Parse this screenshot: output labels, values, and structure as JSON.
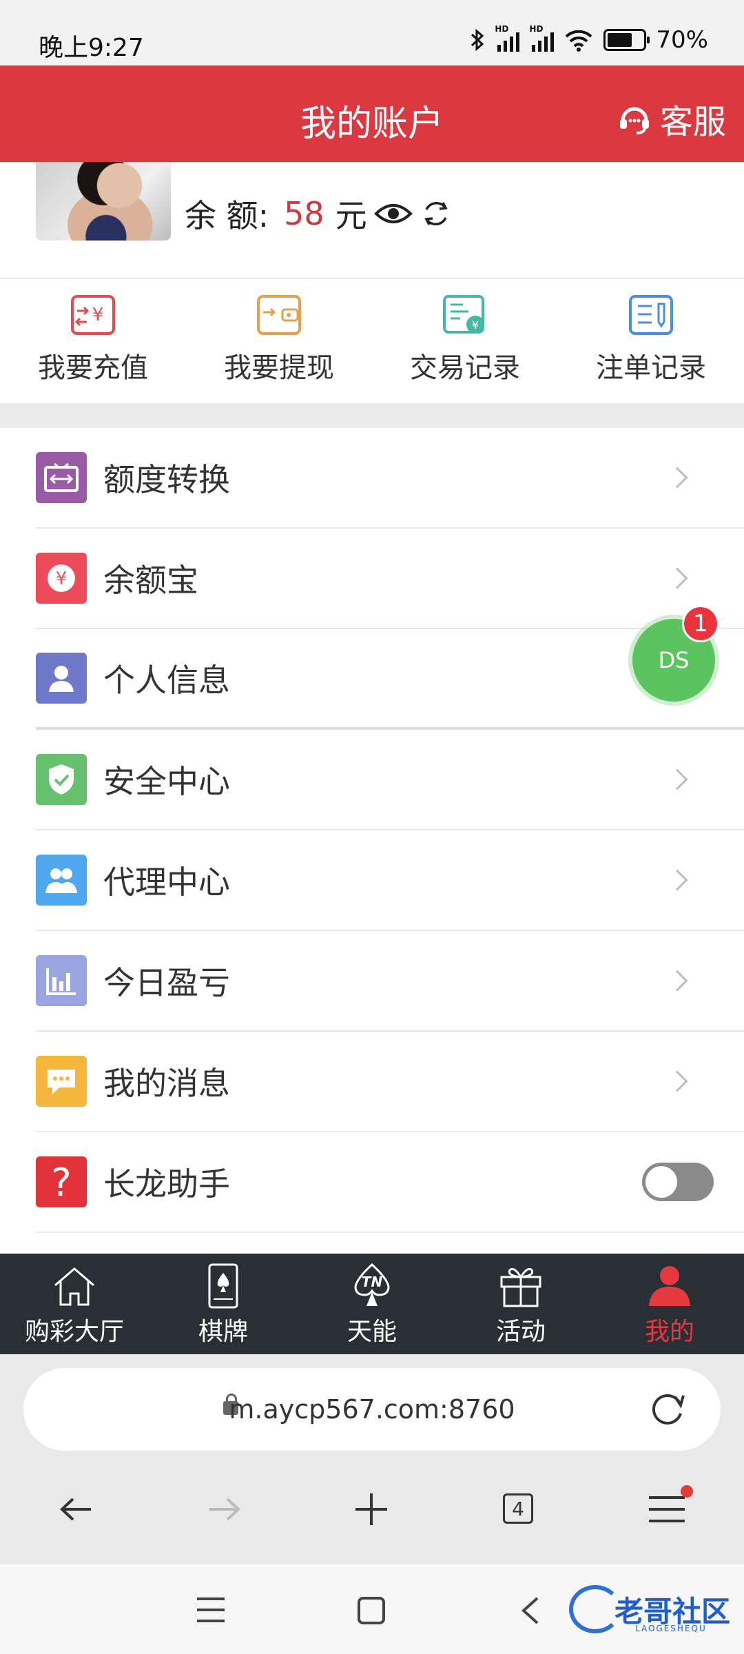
{
  "status_bar": {
    "time": "晚上9:27",
    "battery": "70%",
    "battery_level": 0.7
  },
  "header": {
    "title": "我的账户",
    "service_label": "客服"
  },
  "profile": {
    "balance_label": "余 额:",
    "balance_value": "58",
    "currency": "元"
  },
  "quick_actions": [
    {
      "label": "我要充值",
      "icon": "recharge-icon",
      "color": "#e24a4f"
    },
    {
      "label": "我要提现",
      "icon": "wallet-icon",
      "color": "#e6a04a"
    },
    {
      "label": "交易记录",
      "icon": "transaction-record-icon",
      "color": "#43b8a6"
    },
    {
      "label": "注单记录",
      "icon": "bet-record-icon",
      "color": "#4a8fd8"
    }
  ],
  "menu": {
    "items": [
      {
        "label": "额度转换",
        "icon": "transfer-icon",
        "color": "#9a5ba6"
      },
      {
        "label": "余额宝",
        "icon": "yuan-icon",
        "color": "#ee4b5a"
      },
      {
        "label": "个人信息",
        "icon": "user-icon",
        "color": "#6f79c9"
      },
      {
        "label": "安全中心",
        "icon": "shield-icon",
        "color": "#67c06d"
      },
      {
        "label": "代理中心",
        "icon": "agents-icon",
        "color": "#4fa8ee"
      },
      {
        "label": "今日盈亏",
        "icon": "bar-chart-icon",
        "color": "#9aa4e0"
      },
      {
        "label": "我的消息",
        "icon": "message-icon",
        "color": "#f5b63d"
      },
      {
        "label": "长龙助手",
        "icon": "question-icon",
        "color": "#e2333b"
      }
    ],
    "toggle_on": false
  },
  "floating": {
    "label": "DS",
    "badge": "1"
  },
  "tabbar": {
    "tabs": [
      {
        "label": "购彩大厅",
        "icon": "home-icon"
      },
      {
        "label": "棋牌",
        "icon": "cards-icon"
      },
      {
        "label": "天能",
        "icon": "tn-icon"
      },
      {
        "label": "活动",
        "icon": "gift-icon"
      },
      {
        "label": "我的",
        "icon": "profile-icon"
      }
    ],
    "active_index": 4
  },
  "browser": {
    "url": "m.aycp567.com:8760",
    "tab_count": "4"
  },
  "watermark": {
    "text": "老哥社区",
    "subtext": "LAOGESHEQU"
  }
}
